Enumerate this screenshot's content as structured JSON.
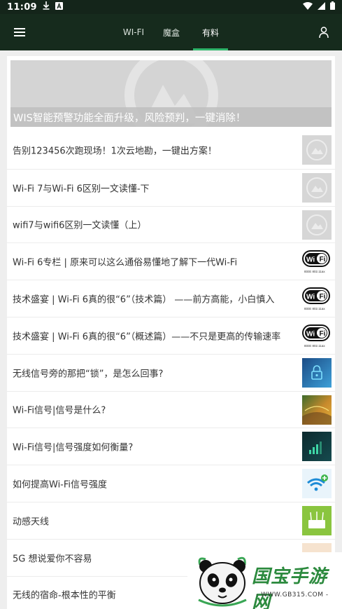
{
  "status_bar": {
    "time": "11:09",
    "icons": [
      "download-icon",
      "a-badge-icon",
      "wifi-icon",
      "cell-signal-icon",
      "battery-icon"
    ]
  },
  "app_bar": {
    "tabs": [
      {
        "label": "WI-FI",
        "active": false
      },
      {
        "label": "魔盒",
        "active": false
      },
      {
        "label": "有料",
        "active": true
      }
    ]
  },
  "banner": {
    "caption": "WIS智能预警功能全面升级，风险预判，一键消除！"
  },
  "articles": [
    {
      "title": "告别123456次跑现场！1次云地勘，一键出方案！",
      "thumb": "placeholder"
    },
    {
      "title": "Wi-Fi 7与Wi-Fi 6区别一文读懂-下",
      "thumb": "placeholder"
    },
    {
      "title": "wifi7与wifi6区别一文读懂（上）",
      "thumb": "placeholder"
    },
    {
      "title": "Wi-Fi 6专栏 | 原来可以这么通俗易懂地了解下一代Wi-Fi",
      "thumb": "wifi-badge"
    },
    {
      "title": "技术盛宴 | Wi-Fi 6真的很“6”（技术篇） ——前方高能，小白慎入",
      "thumb": "wifi-badge"
    },
    {
      "title": "技术盛宴 | Wi-Fi 6真的很“6”（概述篇）——不只是更高的传输速率",
      "thumb": "wifi-badge"
    },
    {
      "title": "无线信号旁的那把“锁”，是怎么回事?",
      "thumb": "lock"
    },
    {
      "title": "Wi-Fi信号|信号是什么?",
      "thumb": "forest"
    },
    {
      "title": "Wi-Fi信号|信号强度如何衡量?",
      "thumb": "signal-dark"
    },
    {
      "title": "如何提高Wi-Fi信号强度",
      "thumb": "wifi-blue"
    },
    {
      "title": "动感天线",
      "thumb": "router"
    },
    {
      "title": "5G 想说爱你不容易",
      "thumb": "pink"
    },
    {
      "title": "无线的宿命-根本性的平衡",
      "thumb": "none"
    }
  ],
  "wifi_badge_text": {
    "main": "Wi Fi",
    "sub": "IEEE 802.11ax"
  },
  "watermark": {
    "text": "国宝手游网",
    "url": "- WWW.GB315.COM -"
  },
  "colors": {
    "header_bg": "#162b1d",
    "tab_indicator": "#2fb56a",
    "watermark_green": "#2c8a3e"
  }
}
